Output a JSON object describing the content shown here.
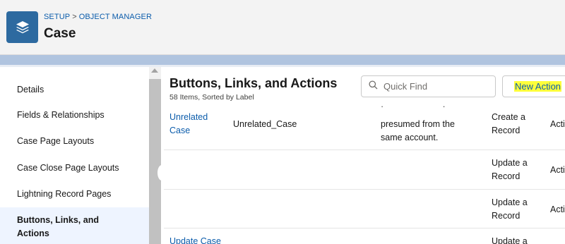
{
  "header": {
    "breadcrumb_setup": "SETUP",
    "breadcrumb_sep": ">",
    "breadcrumb_object_manager": "OBJECT MANAGER",
    "title": "Case",
    "app_icon": "layers-icon"
  },
  "sidebar": {
    "items": [
      {
        "label": "Details"
      },
      {
        "label": "Fields & Relationships"
      },
      {
        "label": "Case Page Layouts"
      },
      {
        "label": "Case Close Page Layouts"
      },
      {
        "label": "Lightning Record Pages"
      },
      {
        "label": "Buttons, Links, and Actions"
      }
    ]
  },
  "section": {
    "title": "Buttons, Links, and Actions",
    "subtitle": "58 Items, Sorted by Label"
  },
  "search": {
    "placeholder": "Quick Find",
    "icon": "search-icon"
  },
  "new_action": {
    "label": "New Action"
  },
  "rows": [
    {
      "label": "Unrelated Case",
      "name": "Unrelated_Case",
      "description": "presumed from the same account.",
      "type": "Create a Record",
      "kind": "Acti"
    },
    {
      "label": "",
      "name": "",
      "description": "",
      "type": "Update a Record",
      "kind": "Acti"
    },
    {
      "label": "",
      "name": "",
      "description": "",
      "type": "Update a Record",
      "kind": "Acti"
    },
    {
      "label": "Update Case",
      "name": "",
      "description": "",
      "type": "Update a",
      "kind": ""
    }
  ],
  "colors": {
    "link": "#0b5cab",
    "highlight": "#ffff3b",
    "brand_icon": "#2d6aa0"
  }
}
